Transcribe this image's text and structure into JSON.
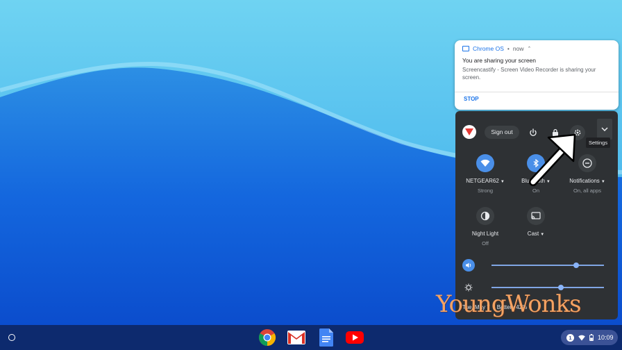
{
  "notification": {
    "app_name": "Chrome OS",
    "separator": "•",
    "time": "now",
    "title": "You are sharing your screen",
    "body": "Screencastify - Screen Video Recorder is sharing your screen.",
    "action": "STOP"
  },
  "quick_settings": {
    "sign_out_label": "Sign out",
    "tooltip": "Settings",
    "tiles": [
      {
        "label": "NETGEAR62",
        "sub": "Strong",
        "icon": "wifi-icon",
        "active": true
      },
      {
        "label": "Bluetooth",
        "sub": "On",
        "icon": "bluetooth-icon",
        "active": true
      },
      {
        "label": "Notifications",
        "sub": "On, all apps",
        "icon": "do-not-disturb-icon",
        "active": false
      },
      {
        "label": "Night Light",
        "sub": "Off",
        "icon": "night-light-icon",
        "active": false
      },
      {
        "label": "Cast",
        "sub": "",
        "icon": "cast-icon",
        "active": false
      }
    ],
    "volume_level": 0.75,
    "brightness_level": 0.62,
    "date": "Tue, May 7",
    "battery": "Battery 42%"
  },
  "shelf": {
    "apps": [
      "chrome-icon",
      "gmail-icon",
      "docs-icon",
      "youtube-icon"
    ],
    "notification_count": "1",
    "clock": "10:09"
  },
  "watermark": "YoungWonks",
  "colors": {
    "accent": "#1a73e8",
    "panel": "#2e3134",
    "tile_on": "#4a8fe8",
    "shelf": "#0d2a6e"
  }
}
